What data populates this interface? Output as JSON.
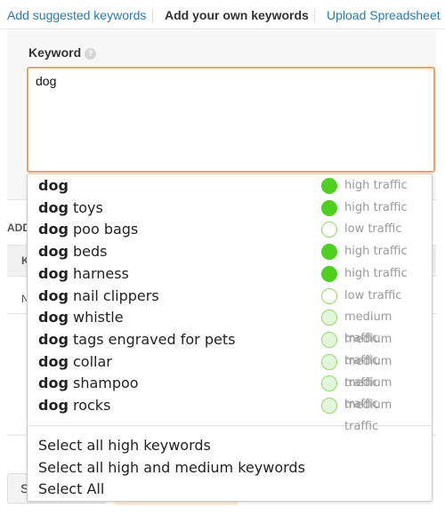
{
  "tabs": [
    {
      "label": "Add suggested keywords",
      "active": false
    },
    {
      "label": "Add your own keywords",
      "active": true
    },
    {
      "label": "Upload Spreadsheet",
      "active": false
    }
  ],
  "keyword": {
    "label": "Keyword",
    "help_icon": "question-circle-icon",
    "value": "dog"
  },
  "background_fragments": {
    "section": "ADD",
    "header": "K",
    "row": "N",
    "button": "S"
  },
  "suggestions": [
    {
      "prefix": "dog",
      "rest": "",
      "traffic": "high",
      "label": "high traffic"
    },
    {
      "prefix": "dog",
      "rest": " toys",
      "traffic": "high",
      "label": "high traffic"
    },
    {
      "prefix": "dog",
      "rest": " poo bags",
      "traffic": "low",
      "label": "low traffic"
    },
    {
      "prefix": "dog",
      "rest": " beds",
      "traffic": "high",
      "label": "high traffic"
    },
    {
      "prefix": "dog",
      "rest": " harness",
      "traffic": "high",
      "label": "high traffic"
    },
    {
      "prefix": "dog",
      "rest": " nail clippers",
      "traffic": "low",
      "label": "low traffic"
    },
    {
      "prefix": "dog",
      "rest": " whistle",
      "traffic": "medium",
      "label": "medium traffic"
    },
    {
      "prefix": "dog",
      "rest": " tags engraved for pets",
      "traffic": "medium",
      "label": "medium traffic"
    },
    {
      "prefix": "dog",
      "rest": " collar",
      "traffic": "medium",
      "label": "medium traffic"
    },
    {
      "prefix": "dog",
      "rest": " shampoo",
      "traffic": "medium",
      "label": "medium traffic"
    },
    {
      "prefix": "dog",
      "rest": " rocks",
      "traffic": "medium",
      "label": "medium traffic"
    }
  ],
  "select_options": [
    "Select all high keywords",
    "Select all high and medium keywords",
    "Select All"
  ],
  "colors": {
    "accent_border": "#f0a060",
    "link": "#2a7ab8",
    "high": "#4fcf1f",
    "medium": "#e4f6da"
  }
}
